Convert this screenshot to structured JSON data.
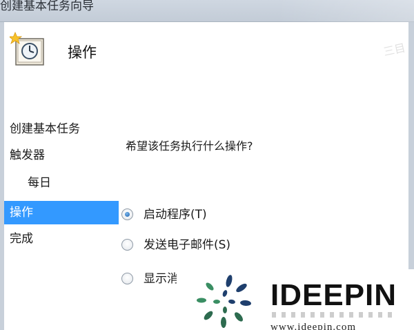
{
  "window": {
    "title": "创建基本任务向导"
  },
  "header": {
    "icon": "task-scheduler-clock-icon",
    "title": "操作"
  },
  "nav": {
    "items": [
      {
        "label": "创建基本任务",
        "level": 0,
        "active": false
      },
      {
        "label": "触发器",
        "level": 0,
        "active": false
      },
      {
        "label": "每日",
        "level": 1,
        "active": false
      },
      {
        "label": "操作",
        "level": 0,
        "active": true
      },
      {
        "label": "完成",
        "level": 0,
        "active": false
      }
    ]
  },
  "content": {
    "question": "希望该任务执行什么操作?",
    "options": [
      {
        "label": "启动程序(T)",
        "checked": true
      },
      {
        "label": "发送电子邮件(S)",
        "checked": false
      },
      {
        "label": "显示消",
        "checked": false
      }
    ]
  },
  "watermark": {
    "brand": "IDEEPIN",
    "url": "www.ideepin.com",
    "corner_text": "三目"
  },
  "colors": {
    "selection": "#3399ff",
    "titlebar": "#c8d0da"
  }
}
